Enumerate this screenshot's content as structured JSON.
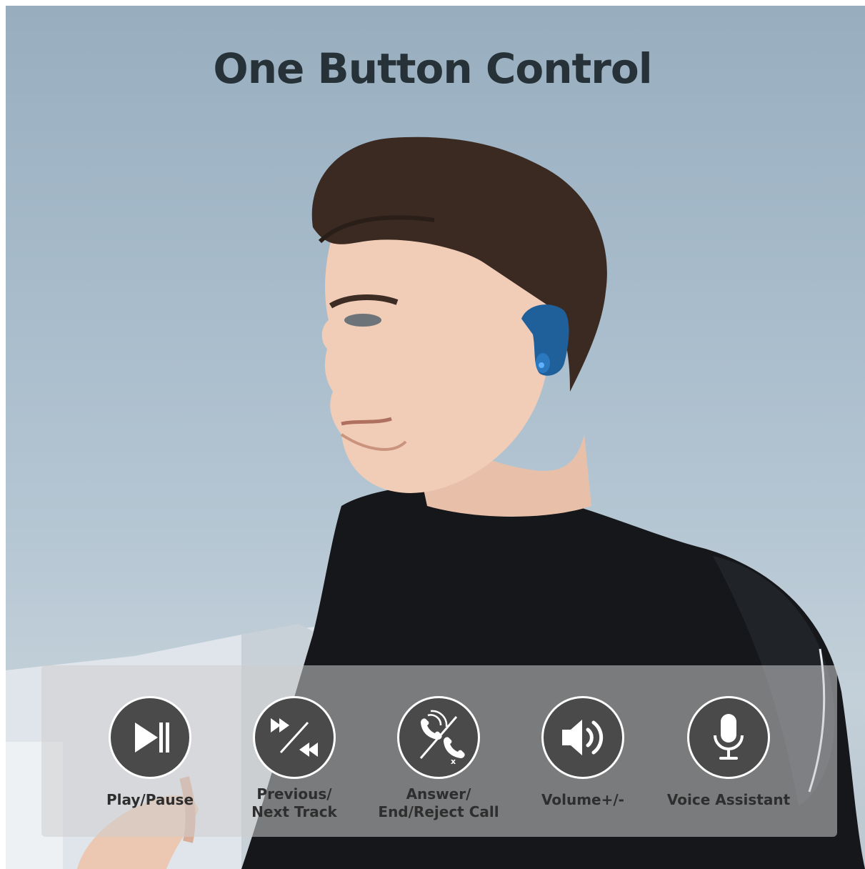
{
  "title": "One Button Control",
  "features": [
    {
      "icon": "play-pause-icon",
      "lines": [
        "Play/Pause"
      ]
    },
    {
      "icon": "previous-next-track-icon",
      "lines": [
        "Previous/",
        "Next Track"
      ]
    },
    {
      "icon": "answer-end-call-icon",
      "lines": [
        "Answer/",
        "End/Reject Call"
      ]
    },
    {
      "icon": "volume-icon",
      "lines": [
        "Volume+/-"
      ]
    },
    {
      "icon": "microphone-icon",
      "lines": [
        "Voice Assistant"
      ]
    }
  ],
  "colors": {
    "title": "#263238",
    "icon_circle": "#4a4a4a",
    "icon_glyph": "#ffffff",
    "earbud": "#1f5f9a",
    "jacket": "#15171a",
    "hair": "#3a2a22"
  }
}
